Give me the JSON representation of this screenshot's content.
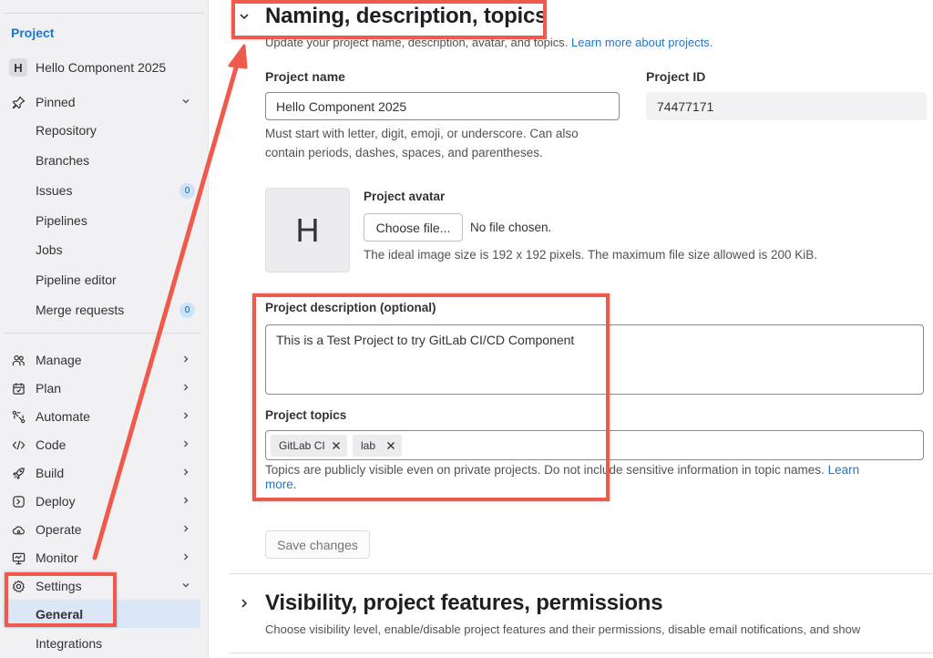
{
  "sidebar": {
    "heading": "Project",
    "project": {
      "initial": "H",
      "name": "Hello Component 2025"
    },
    "pinned": {
      "label": "Pinned",
      "items": [
        {
          "label": "Repository"
        },
        {
          "label": "Branches"
        },
        {
          "label": "Issues",
          "badge": "0"
        },
        {
          "label": "Pipelines"
        },
        {
          "label": "Jobs"
        },
        {
          "label": "Pipeline editor"
        },
        {
          "label": "Merge requests",
          "badge": "0"
        }
      ]
    },
    "sections": [
      {
        "label": "Manage",
        "icon": "users-icon"
      },
      {
        "label": "Plan",
        "icon": "calendar-icon"
      },
      {
        "label": "Automate",
        "icon": "automate-icon"
      },
      {
        "label": "Code",
        "icon": "code-icon"
      },
      {
        "label": "Build",
        "icon": "rocket-icon"
      },
      {
        "label": "Deploy",
        "icon": "deploy-icon"
      },
      {
        "label": "Operate",
        "icon": "cloud-icon"
      },
      {
        "label": "Monitor",
        "icon": "monitor-icon"
      }
    ],
    "settings": {
      "label": "Settings",
      "items": [
        {
          "label": "General",
          "active": true
        },
        {
          "label": "Integrations"
        }
      ]
    }
  },
  "main": {
    "naming": {
      "title": "Naming, description, topics",
      "description": "Update your project name, description, avatar, and topics.",
      "learn_more": "Learn more about projects."
    },
    "project_name": {
      "label": "Project name",
      "value": "Hello Component 2025",
      "help_line1": "Must start with letter, digit, emoji, or underscore. Can also",
      "help_line2": "contain periods, dashes, spaces, and parentheses."
    },
    "project_id": {
      "label": "Project ID",
      "value": "74477171"
    },
    "avatar": {
      "initial": "H",
      "label": "Project avatar",
      "choose_button": "Choose file...",
      "no_file": "No file chosen.",
      "help": "The ideal image size is 192 x 192 pixels. The maximum file size allowed is 200 KiB."
    },
    "description": {
      "label": "Project description (optional)",
      "value": "This is a Test Project to try GitLab CI/CD Component"
    },
    "topics": {
      "label": "Project topics",
      "tokens": [
        "GitLab CI",
        "lab"
      ],
      "help": "Topics are publicly visible even on private projects. Do not include sensitive information in topic names.",
      "learn_more_1": "Learn",
      "learn_more_2": "more."
    },
    "save_button": "Save changes",
    "visibility": {
      "title": "Visibility, project features, permissions",
      "description": "Choose visibility level, enable/disable project features and their permissions, disable email notifications, and show"
    }
  },
  "colors": {
    "annotation": "#ef5a4d",
    "link": "#1f75cb",
    "active_bg": "#dbe7f7"
  }
}
